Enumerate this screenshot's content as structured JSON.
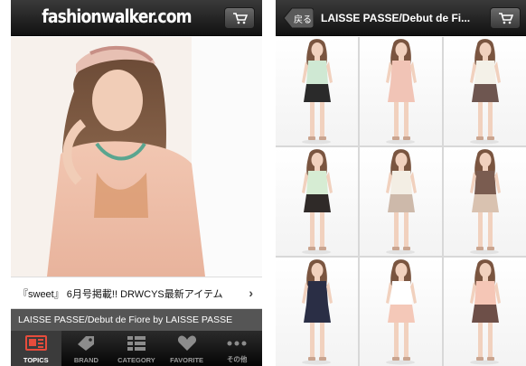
{
  "left_screen": {
    "brand": "fashionwalker.com",
    "cart_icon": "shopping-cart-icon",
    "topic": "『sweet』 6月号掲載!! DRWCYS最新アイテム",
    "topic_arrow": "›",
    "caption": "LAISSE PASSE/Debut de Fiore by LAISSE PASSE",
    "tabs": [
      {
        "label": "TOPICS",
        "icon": "topics-icon",
        "active": true
      },
      {
        "label": "BRAND",
        "icon": "tag-icon",
        "active": false
      },
      {
        "label": "CATEGORY",
        "icon": "category-icon",
        "active": false
      },
      {
        "label": "FAVORITE",
        "icon": "heart-icon",
        "active": false
      },
      {
        "label": "その他",
        "icon": "more-icon",
        "active": false
      }
    ]
  },
  "right_screen": {
    "back_label": "戻る",
    "title": "LAISSE PASSE/Debut de Fi...",
    "cart_icon": "shopping-cart-icon",
    "products": [
      {
        "top": "#cfe8d3",
        "bottom": "#2a2a2a"
      },
      {
        "top": "#f1c4b6",
        "bottom": "#f1c4b6"
      },
      {
        "top": "#f4f1e8",
        "bottom": "#6e5650"
      },
      {
        "top": "#d6ecd3",
        "bottom": "#2f2a28"
      },
      {
        "top": "#f3eee4",
        "bottom": "#cdb9aa"
      },
      {
        "top": "#7a5c50",
        "bottom": "#d9c2b0"
      },
      {
        "top": "#2a2e45",
        "bottom": "#2a2e45"
      },
      {
        "top": "#ffffff",
        "bottom": "#f4c8b8"
      },
      {
        "top": "#f5c6b6",
        "bottom": "#6d4f48"
      }
    ]
  }
}
